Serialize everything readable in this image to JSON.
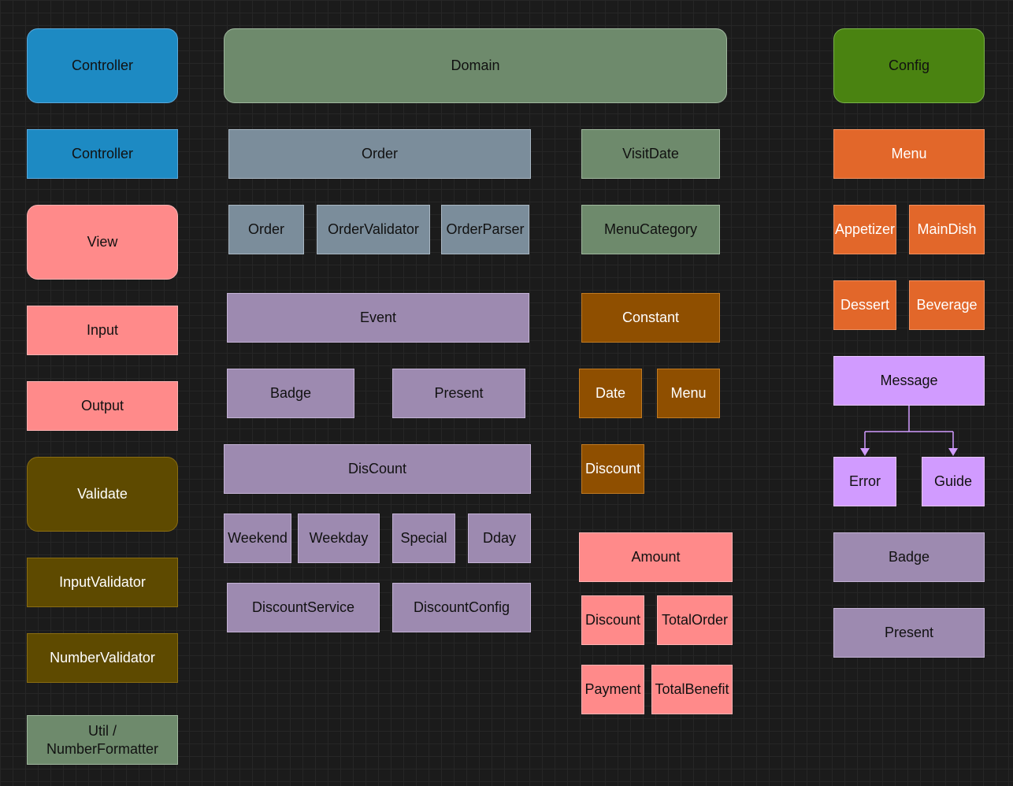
{
  "colors": {
    "controller": "#1d8ac3",
    "view": "#ff8a8a",
    "validate": "#5e4a00",
    "util": "#6e8a6c",
    "domain": "#6e8a6c",
    "order": "#7b8d9b",
    "event": "#9d8ab0",
    "constant": "#8f4f00",
    "amount": "#ff8a8a",
    "config": "#4a8311",
    "menu": "#e2672a",
    "message": "#d19bff",
    "connector": "#d19bff"
  },
  "left": {
    "controller_header": "Controller",
    "controller": "Controller",
    "view_header": "View",
    "input": "Input",
    "output": "Output",
    "validate_header": "Validate",
    "input_validator": "InputValidator",
    "number_validator": "NumberValidator",
    "util": "Util /\nNumberFormatter"
  },
  "domain": {
    "header": "Domain",
    "order": {
      "title": "Order",
      "items": [
        "Order",
        "OrderValidator",
        "OrderParser"
      ]
    },
    "event": {
      "title": "Event",
      "badge": "Badge",
      "present": "Present",
      "discount_title": "DisCount",
      "discount_items": [
        "Weekend",
        "Weekday",
        "Special",
        "Dday"
      ],
      "discount_service": "DiscountService",
      "discount_config": "DiscountConfig"
    },
    "visit_date": "VisitDate",
    "menu_category": "MenuCategory",
    "constant": {
      "title": "Constant",
      "date": "Date",
      "menu": "Menu",
      "discount": "Discount"
    },
    "amount": {
      "title": "Amount",
      "discount": "Discount",
      "total_order": "TotalOrder",
      "payment": "Payment",
      "total_benefit": "TotalBenefit"
    }
  },
  "config": {
    "header": "Config",
    "menu": {
      "title": "Menu",
      "items": [
        "Appetizer",
        "MainDish",
        "Dessert",
        "Beverage"
      ]
    },
    "message": {
      "title": "Message",
      "error": "Error",
      "guide": "Guide"
    },
    "badge": "Badge",
    "present": "Present"
  }
}
